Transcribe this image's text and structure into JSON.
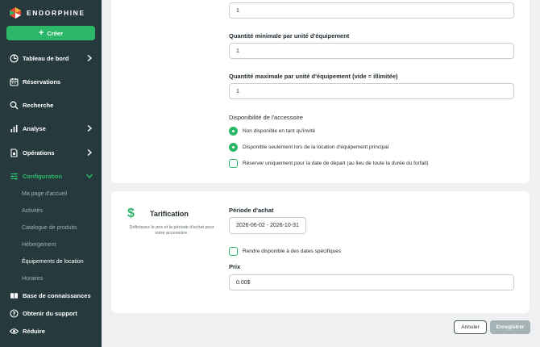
{
  "brand": {
    "name": "ENDORPHINE"
  },
  "sidebar": {
    "create_label": "Créer",
    "items": [
      {
        "label": "Tableau de bord"
      },
      {
        "label": "Réservations"
      },
      {
        "label": "Recherche"
      },
      {
        "label": "Analyse"
      },
      {
        "label": "Opérations"
      },
      {
        "label": "Configuration"
      }
    ],
    "subitems": [
      {
        "label": "Ma page d'accueil"
      },
      {
        "label": "Activités"
      },
      {
        "label": "Catalogue de produits"
      },
      {
        "label": "Hébergement"
      },
      {
        "label": "Équipements de location"
      },
      {
        "label": "Horaires"
      }
    ],
    "bottom": [
      {
        "label": "Base de connaissances"
      },
      {
        "label": "Obtenir du support"
      },
      {
        "label": "Réduire"
      }
    ]
  },
  "form": {
    "top_value": "1",
    "min_label": "Quantité minimale par unité d'équipement",
    "min_value": "1",
    "max_label": "Quantité maximale par unité d'équipement (vide = illimitée)",
    "max_value": "1",
    "availability_label": "Disponibilité de l'accessoire",
    "options": [
      {
        "label": "Non disponible en tant qu'invité",
        "selected": true
      },
      {
        "label": "Disponible seulement lors de la location d'équipement principal",
        "selected": true
      },
      {
        "label": "Réserver uniquement pour la date de départ (au lieu de toute la durée du forfait)",
        "selected": false
      }
    ]
  },
  "pricing": {
    "title": "Tarification",
    "description": "Définissez le prix et la période d'achat pour votre accessoire.",
    "period_label": "Période d'achat",
    "period_value": "2026-06-02 - 2026-10-31",
    "specific_dates_label": "Rendre disponible à des dates spécifiques",
    "price_label": "Prix",
    "price_value": "0.00$"
  },
  "actions": {
    "cancel_label": "Annuler",
    "save_label": "Enregistrer"
  },
  "colors": {
    "accent": "#2bb868",
    "sidebar_bg": "#263a3d",
    "disabled_btn": "#a6b3b6"
  }
}
